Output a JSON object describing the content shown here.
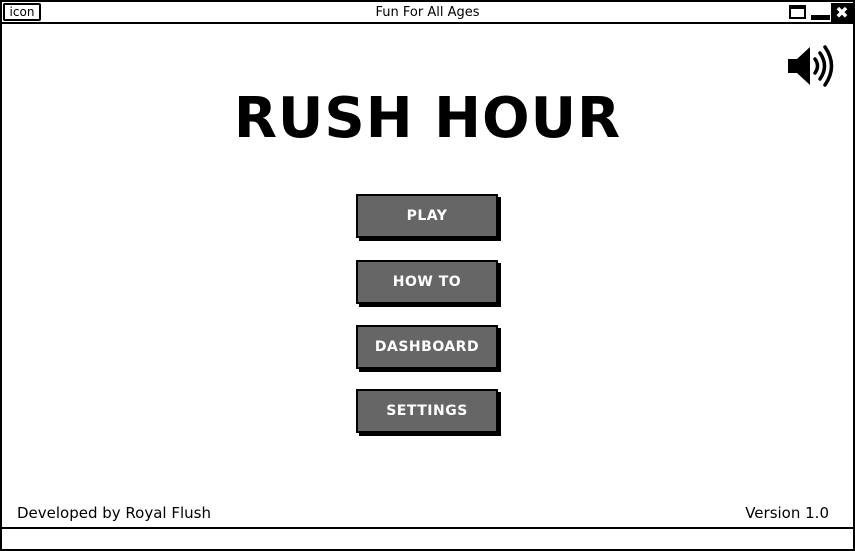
{
  "window": {
    "icon_label": "icon",
    "title": "Fun For All Ages",
    "close_glyph": "✖"
  },
  "main": {
    "game_title": "RUSH HOUR",
    "sound_icon": "speaker-volume-icon",
    "menu": [
      {
        "label": "PLAY"
      },
      {
        "label": "HOW TO"
      },
      {
        "label": "DASHBOARD"
      },
      {
        "label": "SETTINGS"
      }
    ]
  },
  "footer": {
    "credits": "Developed by Royal Flush",
    "version": "Version 1.0"
  },
  "colors": {
    "button_fill": "#666666",
    "border": "#000000",
    "background": "#ffffff"
  }
}
